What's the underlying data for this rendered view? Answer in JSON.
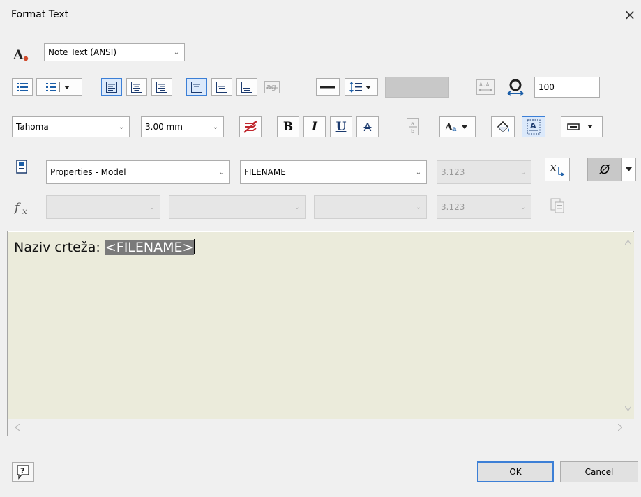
{
  "dialog": {
    "title": "Format Text",
    "close_glyph": "×"
  },
  "row1": {
    "style_combo": "Note Text (ANSI)"
  },
  "row2": {
    "fill_color": "#c8c8c8",
    "stack_value": "100"
  },
  "row3": {
    "font_combo": "Tahoma",
    "size_combo": "3.00 mm",
    "bold_label": "B",
    "italic_label": "I",
    "underline_label": "U",
    "strike_label": "A"
  },
  "row4": {
    "property_type_combo": "Properties - Model",
    "property_combo": "FILENAME",
    "precision_combo": "3.123",
    "symbol_glyph": "Ø"
  },
  "row5": {
    "function_label": "fx",
    "combo1": "",
    "combo2": "",
    "combo3": "",
    "precision_combo": "3.123"
  },
  "editor": {
    "text_prefix": "Naziv crteža: ",
    "text_field": "<FILENAME>",
    "background": "#ebebdb"
  },
  "footer": {
    "help_glyph": "?",
    "ok_label": "OK",
    "cancel_label": "Cancel"
  }
}
